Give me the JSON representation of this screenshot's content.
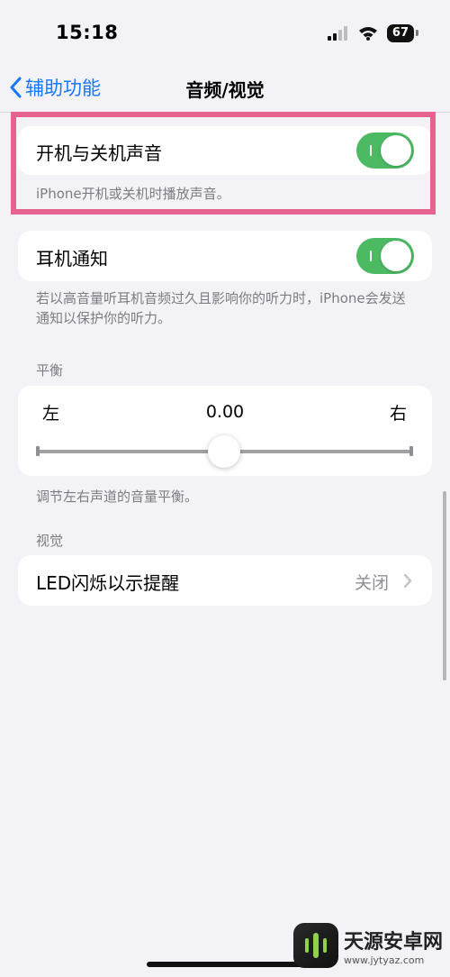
{
  "status": {
    "time": "15:18",
    "battery": "67"
  },
  "nav": {
    "back_label": "辅助功能",
    "title": "音频/视觉"
  },
  "startup_sound": {
    "label": "开机与关机声音",
    "enabled": true,
    "footer": "iPhone开机或关机时播放声音。"
  },
  "headphone": {
    "label": "耳机通知",
    "enabled": true,
    "footer": "若以高音量听耳机音频过久且影响你的听力时，iPhone会发送通知以保护你的听力。"
  },
  "balance": {
    "header": "平衡",
    "left_label": "左",
    "right_label": "右",
    "value": "0.00",
    "position": 0.5,
    "footer": "调节左右声道的音量平衡。"
  },
  "visual": {
    "header": "视觉",
    "led_label": "LED闪烁以示提醒",
    "led_value": "关闭"
  },
  "watermark": {
    "name": "天源安卓网",
    "url": "www.jytyaz.com"
  },
  "colors": {
    "accent": "#1677ff",
    "toggle_on": "#4cb963",
    "highlight": "#e8628f"
  }
}
